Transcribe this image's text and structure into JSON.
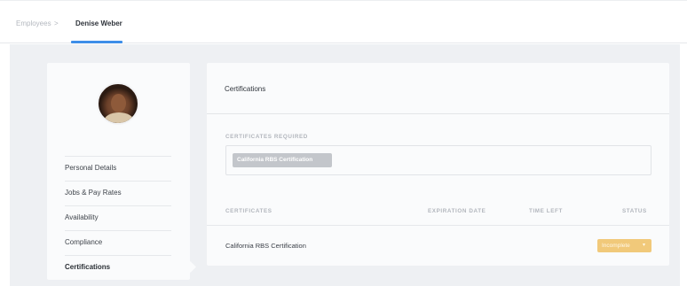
{
  "breadcrumb": {
    "parent": "Employees",
    "separator": ">",
    "current": "Denise Weber"
  },
  "sidebar": {
    "items": [
      {
        "label": "Personal Details"
      },
      {
        "label": "Jobs & Pay Rates"
      },
      {
        "label": "Availability"
      },
      {
        "label": "Compliance"
      },
      {
        "label": "Certifications",
        "active": true
      }
    ]
  },
  "main": {
    "title": "Certifications",
    "required": {
      "label": "CERTIFICATES REQUIRED",
      "tags": [
        "California RBS Certification"
      ]
    },
    "table": {
      "columns": [
        "CERTIFICATES",
        "EXPIRATION DATE",
        "TIME LEFT",
        "STATUS"
      ],
      "rows": [
        {
          "certificate": "California RBS Certification",
          "expiration_date": "",
          "time_left": "",
          "status": "Incomplete"
        }
      ]
    }
  },
  "icons": {
    "status_dropdown": "chevron-down-icon"
  },
  "colors": {
    "accent": "#3d8ee8",
    "status_incomplete": "#f1c97a",
    "tag": "#c3c6cb",
    "canvas": "#eef0f3"
  }
}
